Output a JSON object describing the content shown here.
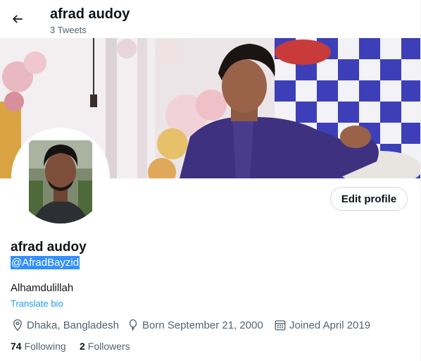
{
  "header": {
    "title": "afrad audoy",
    "tweet_count": "3 Tweets"
  },
  "icons": {
    "back": "arrow-left-icon",
    "location": "location-pin-icon",
    "birth": "balloon-icon",
    "joined": "calendar-icon"
  },
  "profile": {
    "edit_button": "Edit profile",
    "name": "afrad audoy",
    "handle": "@AfradBayzid",
    "bio": "Alhamdulillah",
    "translate": "Translate bio",
    "location": "Dhaka, Bangladesh",
    "birth": "Born September 21, 2000",
    "joined": "Joined April 2019",
    "following_count": "74",
    "following_label": "Following",
    "followers_count": "2",
    "followers_label": "Followers"
  },
  "colors": {
    "accent": "#1d9bf0",
    "secondary_text": "#536471",
    "selection": "#3390ff"
  }
}
